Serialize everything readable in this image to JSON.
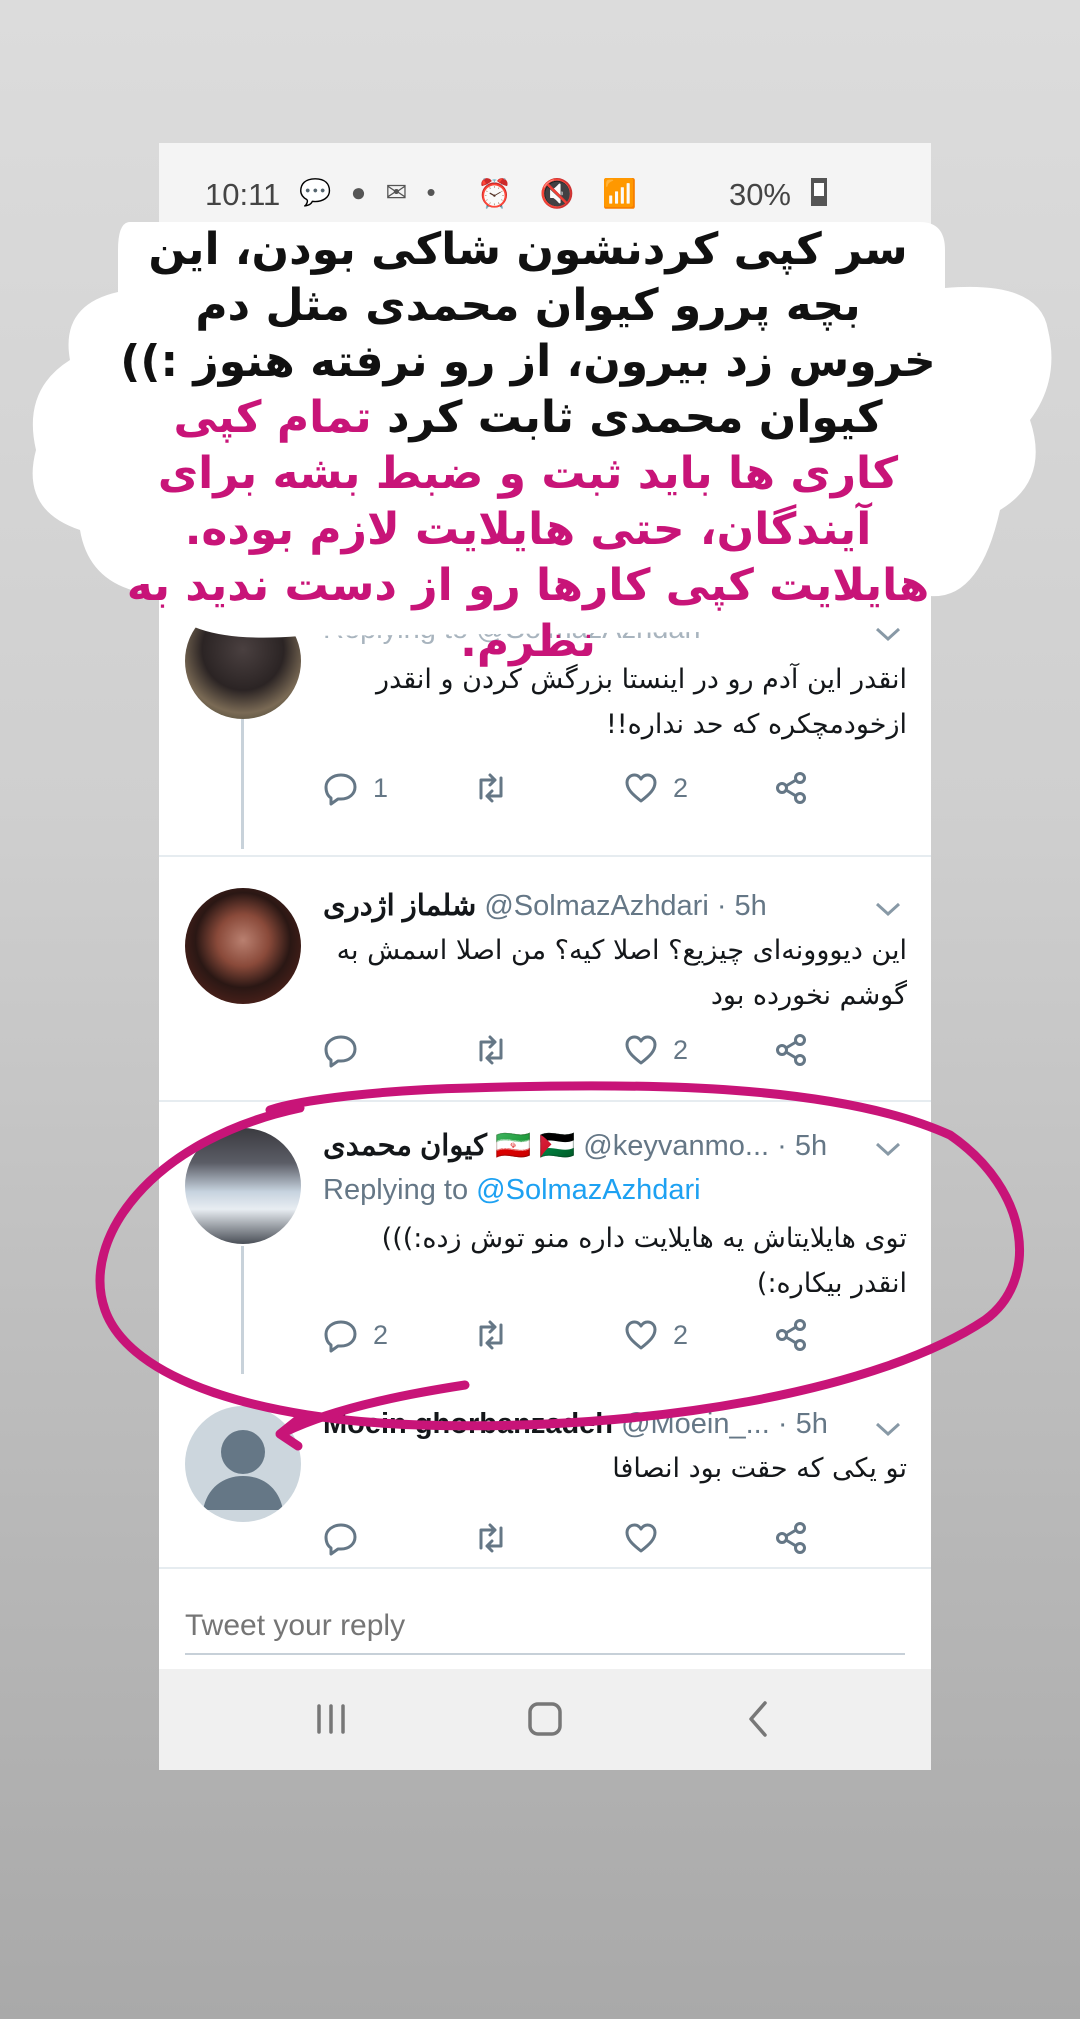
{
  "status_bar": {
    "time": "10:11",
    "notification_icons": "💬 ● ✉ •",
    "system_icons": "⏰ 🔇 📶",
    "battery": "30%"
  },
  "caption": {
    "lines_black": "سر کپی کردنشون شاکی بودن، این بچه پررو کیوان محمدی مثل دم خروس زد بیرون، از رو نرفته هنوز :)) کیوان محمدی ثابت کرد",
    "lines_pink": "تمام کپی کاری ها باید ثبت و ضبط بشه برای آیندگان، حتی هایلایت لازم بوده. هایلایت کپی کارها رو از دست ندید به نظرم.",
    "accent_color": "#c81478"
  },
  "tweets": [
    {
      "header_partial": "Replying to @SolmazAzhdari",
      "text": "انقدر این آدم رو در اینستا بزرگش کردن و انقدر ازخودمچکره که حد نداره!!",
      "reply_count": "1",
      "like_count": "2"
    },
    {
      "name": "شلماز اژدری",
      "handle": "@SolmazAzhdari",
      "time": "· 5h",
      "text": "این دیووونه‌ای چیزیع؟ اصلا کیه؟ من اصلا اسمش به گوشم نخورده بود",
      "reply_count": "",
      "like_count": "2"
    },
    {
      "name": "کیوان محمدی",
      "flags": "🇮🇷 🇵🇸",
      "handle": "@keyvanmo...",
      "time": "· 5h",
      "replying_prefix": "Replying to",
      "replying_handle": "@SolmazAzhdari",
      "text": "توی هایلایتاش یه هایلایت داره منو توش زده:))) انقدر بیکاره:)",
      "reply_count": "2",
      "like_count": "2"
    },
    {
      "name": "Moein ghorbanzadeh",
      "handle": "@Moein_...",
      "time": "· 5h",
      "text": "تو یکی که حقت بود انصافا",
      "reply_count": "",
      "like_count": ""
    }
  ],
  "reply_input": {
    "placeholder": "Tweet your reply"
  },
  "colors": {
    "twitter_blue": "#1da1f2",
    "annotation_magenta": "#c81478"
  }
}
